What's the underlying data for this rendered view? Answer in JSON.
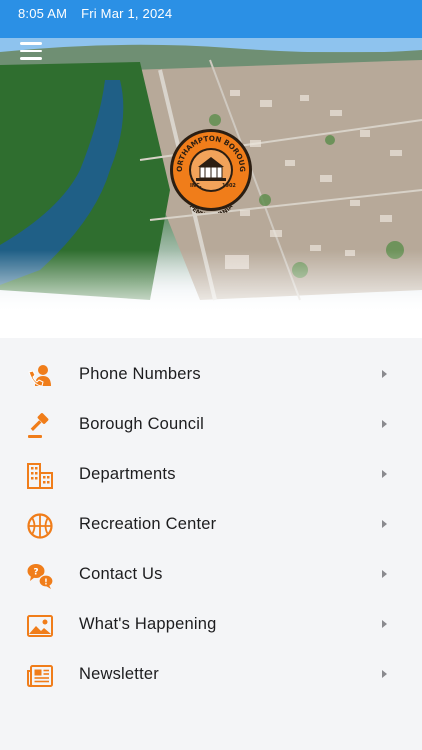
{
  "status_bar": {
    "time": "8:05 AM",
    "date": "Fri Mar 1, 2024"
  },
  "header": {
    "menu_icon": "hamburger-menu-icon"
  },
  "seal": {
    "top_text": "NORTHAMPTON BOROUGH",
    "bottom_text": "PENNSYLVANIA",
    "left_text": "INC.",
    "right_text": "1902"
  },
  "colors": {
    "accent": "#f07d1a",
    "text": "#1d1d1f",
    "chevron": "#8a8a8e"
  },
  "menu": {
    "items": [
      {
        "label": "Phone Numbers",
        "icon": "phone-contact-icon"
      },
      {
        "label": "Borough Council",
        "icon": "gavel-icon"
      },
      {
        "label": "Departments",
        "icon": "buildings-icon"
      },
      {
        "label": "Recreation Center",
        "icon": "basketball-icon"
      },
      {
        "label": "Contact Us",
        "icon": "chat-bubbles-icon"
      },
      {
        "label": "What's Happening",
        "icon": "picture-icon"
      },
      {
        "label": "Newsletter",
        "icon": "newspaper-icon"
      }
    ]
  }
}
